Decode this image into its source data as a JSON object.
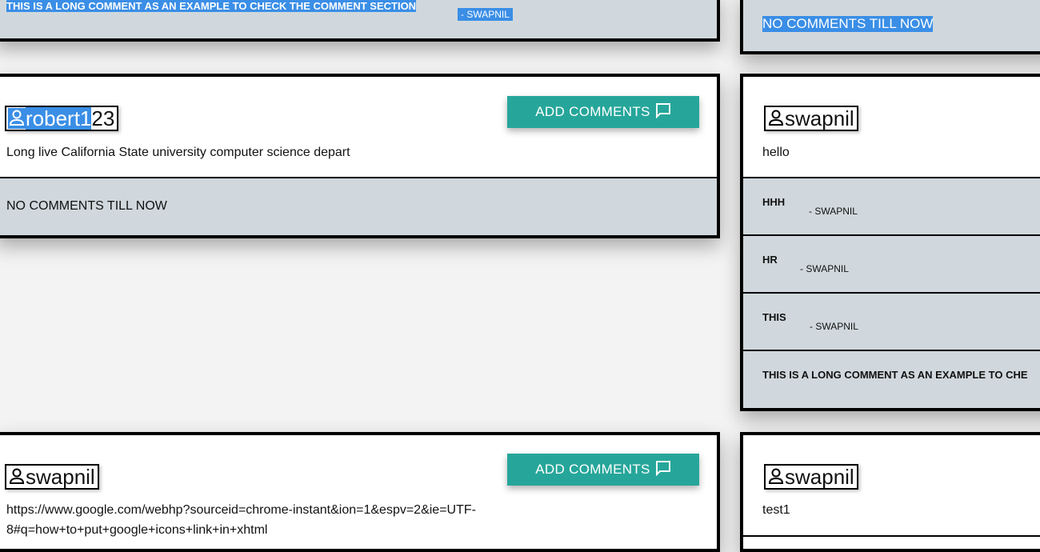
{
  "left_top": {
    "comment_text": "THIS IS A LONG COMMENT AS AN EXAMPLE TO CHECK THE COMMENT SECTION",
    "comment_author": "- SWAPNIL"
  },
  "right_top": {
    "no_comments": "NO COMMENTS TILL NOW"
  },
  "post_robert": {
    "username_selected": "robert1",
    "username_rest": "23",
    "body": "Long live California State university computer science depart",
    "button_label": "ADD COMMENTS",
    "no_comments": "NO COMMENTS TILL NOW"
  },
  "post_right_hello": {
    "username": "swapnil",
    "body": "hello",
    "comments": [
      {
        "text": "HHH",
        "author": "- SWAPNIL"
      },
      {
        "text": "HR",
        "author": "- SWAPNIL"
      },
      {
        "text": "THIS",
        "author": "- SWAPNIL"
      },
      {
        "text": "THIS IS A LONG COMMENT AS AN EXAMPLE TO CHE",
        "author": ""
      }
    ]
  },
  "post_google": {
    "username": "swapnil",
    "body_line1": "https://www.google.com/webhp?sourceid=chrome-instant&ion=1&espv=2&ie=UTF-",
    "body_line2": "8#q=how+to+put+google+icons+link+in+xhtml",
    "button_label": "ADD COMMENTS"
  },
  "post_right_test": {
    "username": "swapnil",
    "body": "test1"
  },
  "colors": {
    "button": "#26a69a",
    "comment_bg": "#d0d8dd",
    "selection": "#3a8ee6"
  },
  "icons": {
    "user": "person-outline-icon",
    "comment": "comment-bubble-icon"
  }
}
